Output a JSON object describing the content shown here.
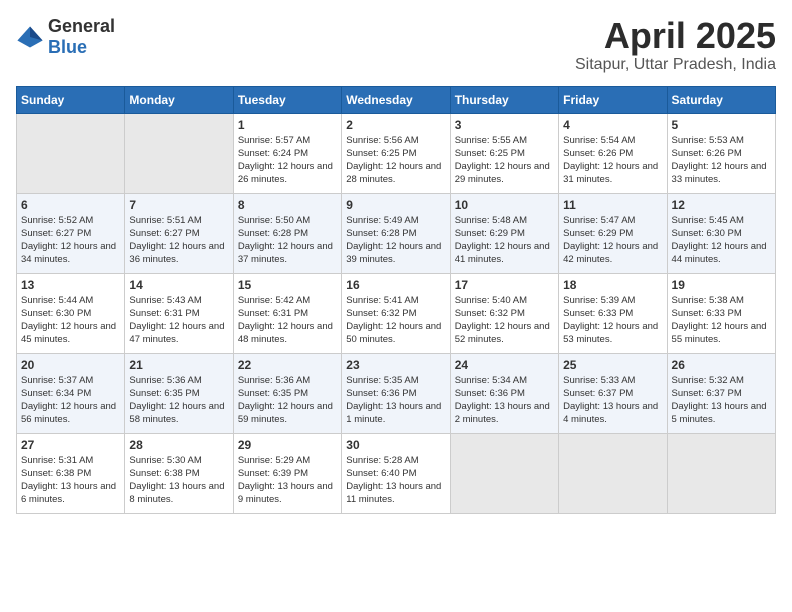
{
  "logo": {
    "general": "General",
    "blue": "Blue"
  },
  "title": "April 2025",
  "subtitle": "Sitapur, Uttar Pradesh, India",
  "days_of_week": [
    "Sunday",
    "Monday",
    "Tuesday",
    "Wednesday",
    "Thursday",
    "Friday",
    "Saturday"
  ],
  "weeks": [
    [
      {
        "day": "",
        "sunrise": "",
        "sunset": "",
        "daylight": ""
      },
      {
        "day": "",
        "sunrise": "",
        "sunset": "",
        "daylight": ""
      },
      {
        "day": "1",
        "sunrise": "Sunrise: 5:57 AM",
        "sunset": "Sunset: 6:24 PM",
        "daylight": "Daylight: 12 hours and 26 minutes."
      },
      {
        "day": "2",
        "sunrise": "Sunrise: 5:56 AM",
        "sunset": "Sunset: 6:25 PM",
        "daylight": "Daylight: 12 hours and 28 minutes."
      },
      {
        "day": "3",
        "sunrise": "Sunrise: 5:55 AM",
        "sunset": "Sunset: 6:25 PM",
        "daylight": "Daylight: 12 hours and 29 minutes."
      },
      {
        "day": "4",
        "sunrise": "Sunrise: 5:54 AM",
        "sunset": "Sunset: 6:26 PM",
        "daylight": "Daylight: 12 hours and 31 minutes."
      },
      {
        "day": "5",
        "sunrise": "Sunrise: 5:53 AM",
        "sunset": "Sunset: 6:26 PM",
        "daylight": "Daylight: 12 hours and 33 minutes."
      }
    ],
    [
      {
        "day": "6",
        "sunrise": "Sunrise: 5:52 AM",
        "sunset": "Sunset: 6:27 PM",
        "daylight": "Daylight: 12 hours and 34 minutes."
      },
      {
        "day": "7",
        "sunrise": "Sunrise: 5:51 AM",
        "sunset": "Sunset: 6:27 PM",
        "daylight": "Daylight: 12 hours and 36 minutes."
      },
      {
        "day": "8",
        "sunrise": "Sunrise: 5:50 AM",
        "sunset": "Sunset: 6:28 PM",
        "daylight": "Daylight: 12 hours and 37 minutes."
      },
      {
        "day": "9",
        "sunrise": "Sunrise: 5:49 AM",
        "sunset": "Sunset: 6:28 PM",
        "daylight": "Daylight: 12 hours and 39 minutes."
      },
      {
        "day": "10",
        "sunrise": "Sunrise: 5:48 AM",
        "sunset": "Sunset: 6:29 PM",
        "daylight": "Daylight: 12 hours and 41 minutes."
      },
      {
        "day": "11",
        "sunrise": "Sunrise: 5:47 AM",
        "sunset": "Sunset: 6:29 PM",
        "daylight": "Daylight: 12 hours and 42 minutes."
      },
      {
        "day": "12",
        "sunrise": "Sunrise: 5:45 AM",
        "sunset": "Sunset: 6:30 PM",
        "daylight": "Daylight: 12 hours and 44 minutes."
      }
    ],
    [
      {
        "day": "13",
        "sunrise": "Sunrise: 5:44 AM",
        "sunset": "Sunset: 6:30 PM",
        "daylight": "Daylight: 12 hours and 45 minutes."
      },
      {
        "day": "14",
        "sunrise": "Sunrise: 5:43 AM",
        "sunset": "Sunset: 6:31 PM",
        "daylight": "Daylight: 12 hours and 47 minutes."
      },
      {
        "day": "15",
        "sunrise": "Sunrise: 5:42 AM",
        "sunset": "Sunset: 6:31 PM",
        "daylight": "Daylight: 12 hours and 48 minutes."
      },
      {
        "day": "16",
        "sunrise": "Sunrise: 5:41 AM",
        "sunset": "Sunset: 6:32 PM",
        "daylight": "Daylight: 12 hours and 50 minutes."
      },
      {
        "day": "17",
        "sunrise": "Sunrise: 5:40 AM",
        "sunset": "Sunset: 6:32 PM",
        "daylight": "Daylight: 12 hours and 52 minutes."
      },
      {
        "day": "18",
        "sunrise": "Sunrise: 5:39 AM",
        "sunset": "Sunset: 6:33 PM",
        "daylight": "Daylight: 12 hours and 53 minutes."
      },
      {
        "day": "19",
        "sunrise": "Sunrise: 5:38 AM",
        "sunset": "Sunset: 6:33 PM",
        "daylight": "Daylight: 12 hours and 55 minutes."
      }
    ],
    [
      {
        "day": "20",
        "sunrise": "Sunrise: 5:37 AM",
        "sunset": "Sunset: 6:34 PM",
        "daylight": "Daylight: 12 hours and 56 minutes."
      },
      {
        "day": "21",
        "sunrise": "Sunrise: 5:36 AM",
        "sunset": "Sunset: 6:35 PM",
        "daylight": "Daylight: 12 hours and 58 minutes."
      },
      {
        "day": "22",
        "sunrise": "Sunrise: 5:36 AM",
        "sunset": "Sunset: 6:35 PM",
        "daylight": "Daylight: 12 hours and 59 minutes."
      },
      {
        "day": "23",
        "sunrise": "Sunrise: 5:35 AM",
        "sunset": "Sunset: 6:36 PM",
        "daylight": "Daylight: 13 hours and 1 minute."
      },
      {
        "day": "24",
        "sunrise": "Sunrise: 5:34 AM",
        "sunset": "Sunset: 6:36 PM",
        "daylight": "Daylight: 13 hours and 2 minutes."
      },
      {
        "day": "25",
        "sunrise": "Sunrise: 5:33 AM",
        "sunset": "Sunset: 6:37 PM",
        "daylight": "Daylight: 13 hours and 4 minutes."
      },
      {
        "day": "26",
        "sunrise": "Sunrise: 5:32 AM",
        "sunset": "Sunset: 6:37 PM",
        "daylight": "Daylight: 13 hours and 5 minutes."
      }
    ],
    [
      {
        "day": "27",
        "sunrise": "Sunrise: 5:31 AM",
        "sunset": "Sunset: 6:38 PM",
        "daylight": "Daylight: 13 hours and 6 minutes."
      },
      {
        "day": "28",
        "sunrise": "Sunrise: 5:30 AM",
        "sunset": "Sunset: 6:38 PM",
        "daylight": "Daylight: 13 hours and 8 minutes."
      },
      {
        "day": "29",
        "sunrise": "Sunrise: 5:29 AM",
        "sunset": "Sunset: 6:39 PM",
        "daylight": "Daylight: 13 hours and 9 minutes."
      },
      {
        "day": "30",
        "sunrise": "Sunrise: 5:28 AM",
        "sunset": "Sunset: 6:40 PM",
        "daylight": "Daylight: 13 hours and 11 minutes."
      },
      {
        "day": "",
        "sunrise": "",
        "sunset": "",
        "daylight": ""
      },
      {
        "day": "",
        "sunrise": "",
        "sunset": "",
        "daylight": ""
      },
      {
        "day": "",
        "sunrise": "",
        "sunset": "",
        "daylight": ""
      }
    ]
  ]
}
